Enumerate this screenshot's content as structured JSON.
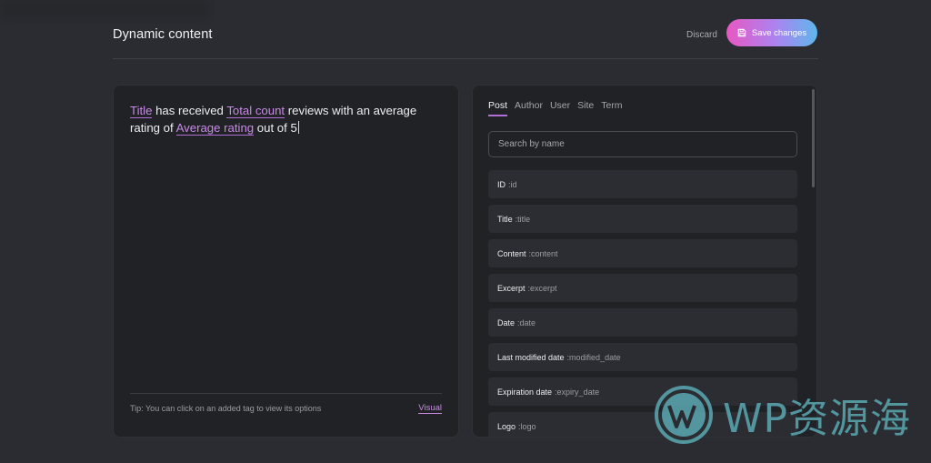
{
  "header": {
    "title": "Dynamic content",
    "discard_label": "Discard",
    "save_label": "Save changes"
  },
  "editor": {
    "segments": [
      {
        "type": "tag",
        "text": "Title"
      },
      {
        "type": "text",
        "text": " has received "
      },
      {
        "type": "tag",
        "text": "Total count"
      },
      {
        "type": "text",
        "text": " reviews with an average rating of "
      },
      {
        "type": "tag",
        "text": "Average rating"
      },
      {
        "type": "text",
        "text": " out of 5"
      }
    ],
    "tip": "Tip: You can click on an added tag to view its options",
    "visual_label": "Visual"
  },
  "side": {
    "tabs": [
      {
        "label": "Post",
        "active": true
      },
      {
        "label": "Author",
        "active": false
      },
      {
        "label": "User",
        "active": false
      },
      {
        "label": "Site",
        "active": false
      },
      {
        "label": "Term",
        "active": false
      }
    ],
    "search_placeholder": "Search by name",
    "fields": [
      {
        "name": "ID",
        "key": ":id"
      },
      {
        "name": "Title",
        "key": ":title"
      },
      {
        "name": "Content",
        "key": ":content"
      },
      {
        "name": "Excerpt",
        "key": ":excerpt"
      },
      {
        "name": "Date",
        "key": ":date"
      },
      {
        "name": "Last modified date",
        "key": ":modified_date"
      },
      {
        "name": "Expiration date",
        "key": ":expiry_date"
      },
      {
        "name": "Logo",
        "key": ":logo"
      }
    ]
  },
  "watermark": {
    "text": "WP资源海",
    "icon": "wordpress-logo-icon",
    "color": "#5aa9b2"
  },
  "colors": {
    "accent": "#b36fd8",
    "background": "#2a2c31",
    "panel": "#202226"
  }
}
